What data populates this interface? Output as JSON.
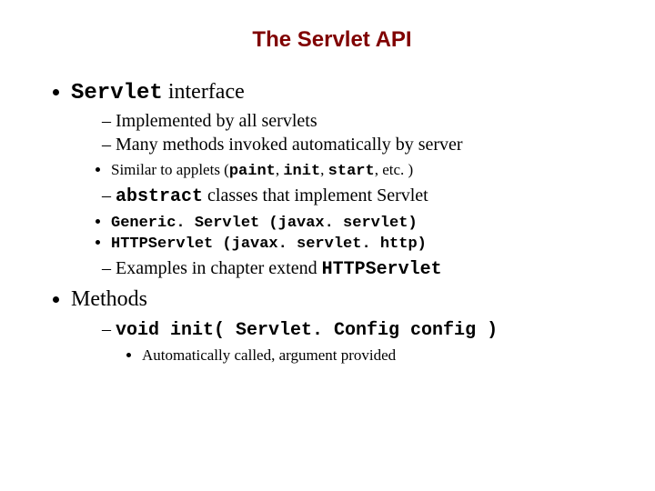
{
  "title": "The Servlet API",
  "b1": {
    "code": "Servlet",
    "rest": " interface"
  },
  "b1_1": "Implemented by all servlets",
  "b1_2": "Many methods invoked automatically by server",
  "b1_2_1": {
    "pre": "Similar to applets (",
    "c1": "paint",
    "s1": ", ",
    "c2": "init",
    "s2": ", ",
    "c3": "start",
    "post": ", etc. )"
  },
  "b1_3": {
    "code": "abstract",
    "rest": " classes that implement Servlet"
  },
  "b1_3_1": "Generic. Servlet (javax. servlet)",
  "b1_3_2": "HTTPServlet (javax. servlet. http)",
  "b1_4": {
    "pre": "Examples in chapter extend ",
    "code": "HTTPServlet"
  },
  "b2": "Methods",
  "b2_1": "void init( Servlet. Config config )",
  "b2_1_1": "Automatically called, argument provided"
}
